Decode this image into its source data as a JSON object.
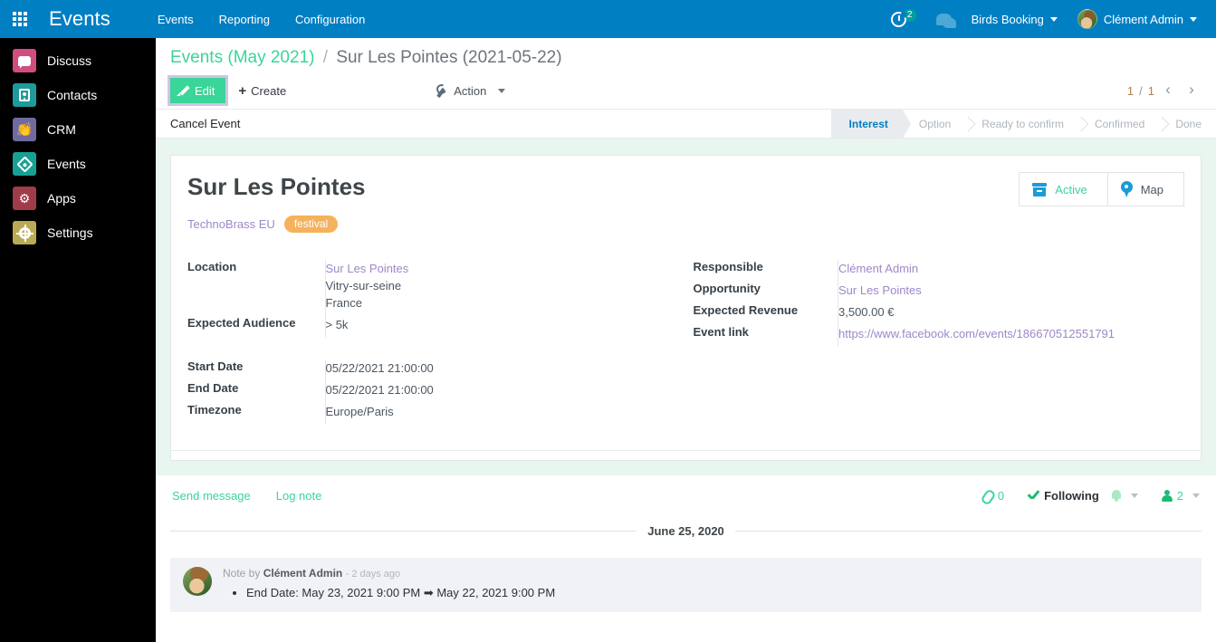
{
  "navbar": {
    "apps_icon": "grid-apps-icon",
    "brand": "Events",
    "menu": [
      {
        "label": "Events"
      },
      {
        "label": "Reporting"
      },
      {
        "label": "Configuration"
      }
    ],
    "activity_icon": "activity-clock-icon",
    "activity_count": "2",
    "messaging_icon": "chat-bubble-icon",
    "company": "Birds Booking",
    "user": "Clément Admin",
    "colors": {
      "background": "#017fc3",
      "badge": "#00a09d"
    }
  },
  "sidebar": {
    "items": [
      {
        "label": "Discuss",
        "icon": "discuss-icon",
        "color": "#d14d7f"
      },
      {
        "label": "Contacts",
        "icon": "contacts-icon",
        "color": "#1f9b9b"
      },
      {
        "label": "CRM",
        "icon": "crm-icon",
        "color": "#6f6b9e"
      },
      {
        "label": "Events",
        "icon": "events-icon",
        "color": "#18a193"
      },
      {
        "label": "Apps",
        "icon": "apps-icon",
        "color": "#a03c4a"
      },
      {
        "label": "Settings",
        "icon": "settings-gear-icon",
        "color": "#b9ab55"
      }
    ]
  },
  "control_panel": {
    "breadcrumb": {
      "parent": "Events (May 2021)",
      "separator": "/",
      "current": "Sur Les Pointes (2021-05-22)"
    },
    "edit_label": "Edit",
    "create_label": "Create",
    "action_label": "Action",
    "pager": {
      "current": "1",
      "separator": "/",
      "total": "1"
    }
  },
  "statusbar": {
    "cancel_event_label": "Cancel Event",
    "steps": [
      {
        "label": "Interest",
        "active": true
      },
      {
        "label": "Option",
        "active": false
      },
      {
        "label": "Ready to confirm",
        "active": false
      },
      {
        "label": "Confirmed",
        "active": false
      },
      {
        "label": "Done",
        "active": false
      }
    ],
    "active_color": "#017fc3"
  },
  "record": {
    "title": "Sur Les Pointes",
    "partner": "TechnoBrass EU",
    "tag": "festival",
    "tag_color": "#f5b25d",
    "stat_buttons": [
      {
        "label": "Active",
        "icon": "archive-box-icon"
      },
      {
        "label": "Map",
        "icon": "map-marker-icon"
      }
    ],
    "left_fields": [
      {
        "label": "Location",
        "values": [
          "Sur Les Pointes",
          "Vitry-sur-seine",
          "France"
        ],
        "link_first": true
      },
      {
        "label": "Expected Audience",
        "values": [
          "> 5k"
        ],
        "link_first": false
      }
    ],
    "left_fields_2": [
      {
        "label": "Start Date",
        "values": [
          "05/22/2021 21:00:00"
        ],
        "link_first": false
      },
      {
        "label": "End Date",
        "values": [
          "05/22/2021 21:00:00"
        ],
        "link_first": false
      },
      {
        "label": "Timezone",
        "values": [
          "Europe/Paris"
        ],
        "link_first": false
      }
    ],
    "right_fields": [
      {
        "label": "Responsible",
        "values": [
          "Clément Admin"
        ],
        "link_first": true
      },
      {
        "label": "Opportunity",
        "values": [
          "Sur Les Pointes"
        ],
        "link_first": true
      },
      {
        "label": "Expected Revenue",
        "values": [
          "3,500.00 €"
        ],
        "link_first": false
      },
      {
        "label": "Event link",
        "values": [
          "https://www.facebook.com/events/186670512551791"
        ],
        "link_first": true
      }
    ]
  },
  "chatter": {
    "send_message_label": "Send message",
    "log_note_label": "Log note",
    "attachment_count": "0",
    "follow_label": "Following",
    "followers_count": "2",
    "date_separator": "June 25, 2020",
    "message": {
      "prefix": "Note by",
      "author": "Clément Admin",
      "time": "- 2 days ago",
      "lines": [
        "End Date: May 23, 2021 9:00 PM ➡ May 22, 2021 9:00 PM"
      ]
    }
  }
}
